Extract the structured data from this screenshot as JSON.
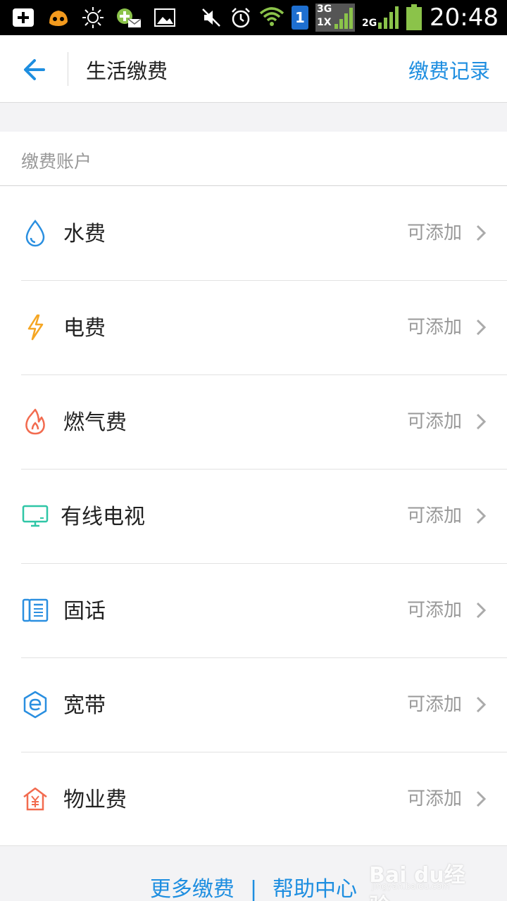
{
  "status_bar": {
    "time": "20:48",
    "sim_label": "1",
    "net_top": "3G",
    "net_bottom": "1X",
    "net2": "2G"
  },
  "header": {
    "title": "生活缴费",
    "action": "缴费记录"
  },
  "section": {
    "title": "缴费账户"
  },
  "items": [
    {
      "label": "水费",
      "status": "可添加",
      "icon": "water-drop-icon",
      "color": "#2a8fe0"
    },
    {
      "label": "电费",
      "status": "可添加",
      "icon": "lightning-icon",
      "color": "#f5a623"
    },
    {
      "label": "燃气费",
      "status": "可添加",
      "icon": "flame-icon",
      "color": "#f26b4f"
    },
    {
      "label": "有线电视",
      "status": "可添加",
      "icon": "tv-icon",
      "color": "#2fc6a6"
    },
    {
      "label": "固话",
      "status": "可添加",
      "icon": "phone-icon",
      "color": "#2a8fe0"
    },
    {
      "label": "宽带",
      "status": "可添加",
      "icon": "broadband-icon",
      "color": "#2a8fe0"
    },
    {
      "label": "物业费",
      "status": "可添加",
      "icon": "property-house-icon",
      "color": "#f26b4f"
    }
  ],
  "footer": {
    "more": "更多缴费",
    "divider": "|",
    "help": "帮助中心"
  },
  "watermark": {
    "brand": "Bai du经验",
    "url": "jingyan.baidu.com"
  },
  "colors": {
    "accent": "#1e8ee0",
    "text": "#222222",
    "muted": "#999999"
  }
}
